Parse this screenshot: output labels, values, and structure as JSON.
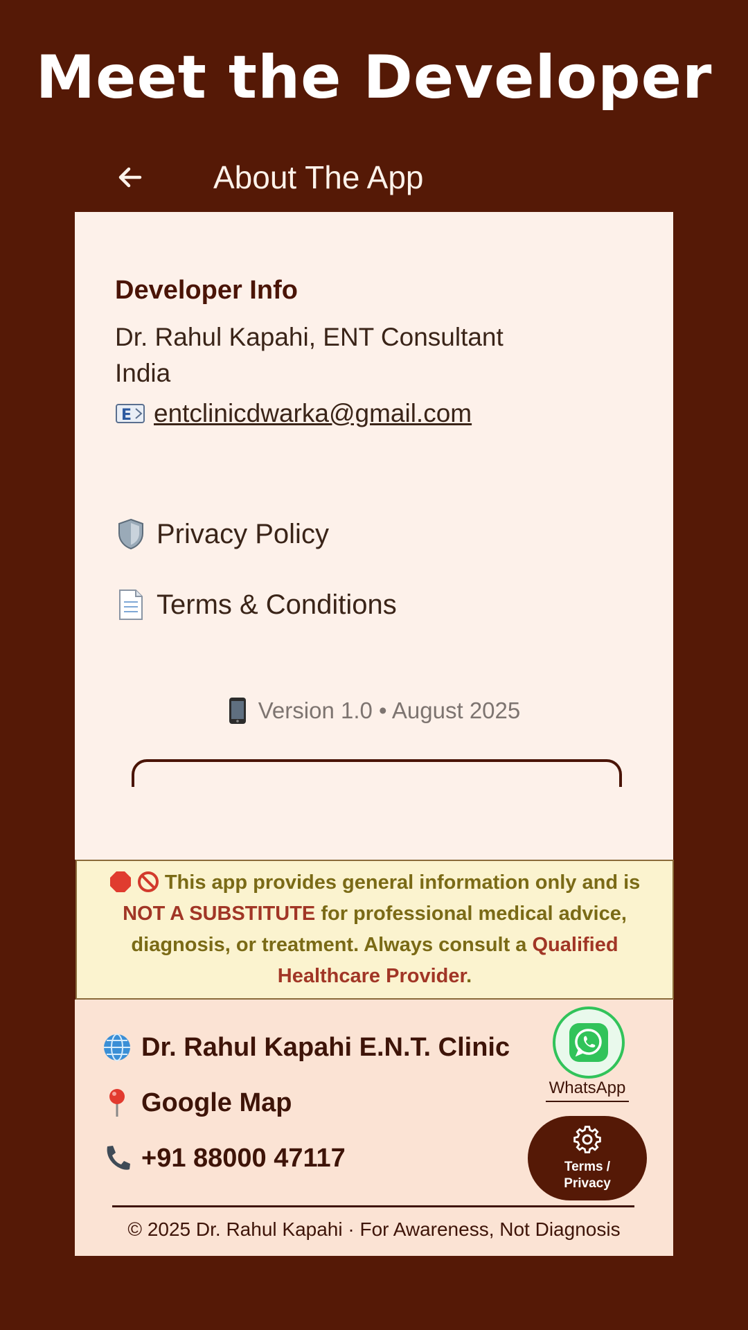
{
  "headline": "Meet the Developer",
  "topbar": {
    "title": "About The App"
  },
  "developer": {
    "heading": "Developer Info",
    "name_line": "Dr. Rahul Kapahi, ENT Consultant",
    "country": "India",
    "email": "entclinicdwarka@gmail.com"
  },
  "links": {
    "privacy": "Privacy Policy",
    "terms": "Terms & Conditions"
  },
  "version": "Version 1.0 • August 2025",
  "disclaimer": {
    "part1": "This app provides general information only and is ",
    "emph1": "NOT A SUBSTITUTE",
    "part2": " for professional medical advice, diagnosis, or treatment. Always consult a ",
    "emph2": "Qualified Healthcare Provider",
    "part3": "."
  },
  "footer": {
    "clinic": "Dr. Rahul Kapahi E.N.T. Clinic",
    "map": "Google Map",
    "phone": "+91 88000 47117",
    "whatsapp_label": "WhatsApp",
    "terms_fab_line1": "Terms /",
    "terms_fab_line2": "Privacy",
    "copyright": "© 2025 Dr. Rahul Kapahi · For Awareness, Not Diagnosis"
  },
  "colors": {
    "background": "#551906",
    "panel": "#fdf1ea",
    "disclaimer_bg": "#fbf3cf",
    "footer_bg": "#fbe3d4",
    "whatsapp": "#31c35a"
  },
  "icons": {
    "back": "arrow-left-icon",
    "email": "email-icon",
    "privacy": "shield-icon",
    "terms": "document-icon",
    "version": "phone-icon",
    "stop": "stop-sign-icon",
    "prohibited": "prohibited-icon",
    "globe": "globe-icon",
    "map": "map-pin-icon",
    "phone": "telephone-icon",
    "whatsapp": "whatsapp-icon",
    "settings": "gear-icon"
  }
}
